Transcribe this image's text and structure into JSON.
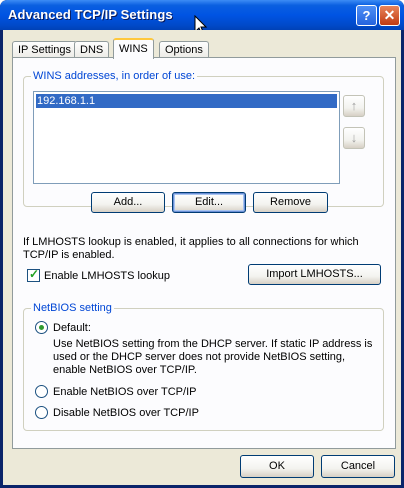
{
  "window": {
    "title": "Advanced TCP/IP Settings",
    "help_label": "?",
    "close_label": "✕"
  },
  "tabs": [
    {
      "label": "IP Settings"
    },
    {
      "label": "DNS"
    },
    {
      "label": "WINS"
    },
    {
      "label": "Options"
    }
  ],
  "active_tab": "WINS",
  "wins": {
    "group_label": "WINS addresses, in order of use:",
    "addresses": [
      "192.168.1.1"
    ],
    "up_icon": "↑",
    "down_icon": "↓",
    "add_label": "Add...",
    "edit_label": "Edit...",
    "remove_label": "Remove"
  },
  "lmhosts": {
    "info": "If LMHOSTS lookup is enabled, it applies to all connections for which TCP/IP is enabled.",
    "info_line1": "If LMHOSTS lookup is enabled, it applies to all connections for which",
    "info_line2": "TCP/IP is enabled.",
    "enable_label": "Enable LMHOSTS lookup",
    "enabled": true,
    "import_label": "Import LMHOSTS..."
  },
  "netbios": {
    "group_label": "NetBIOS setting",
    "selected": "default",
    "default_label": "Default:",
    "default_desc_line1": "Use NetBIOS setting from the DHCP server. If static IP address is",
    "default_desc_line2": "used or the DHCP server does not provide NetBIOS setting,",
    "default_desc_line3": "enable NetBIOS over TCP/IP.",
    "enable_label": "Enable NetBIOS over TCP/IP",
    "disable_label": "Disable NetBIOS over TCP/IP"
  },
  "footer": {
    "ok_label": "OK",
    "cancel_label": "Cancel"
  }
}
